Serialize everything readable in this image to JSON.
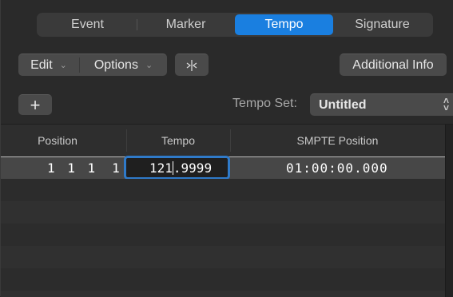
{
  "tabs": [
    {
      "label": "Event"
    },
    {
      "label": "Marker"
    },
    {
      "label": "Tempo"
    },
    {
      "label": "Signature"
    }
  ],
  "active_tab": "Tempo",
  "toolbar": {
    "edit_label": "Edit",
    "options_label": "Options",
    "catch_icon": "catch-playhead-icon",
    "additional_info_label": "Additional Info"
  },
  "tempo_set": {
    "add_label": "+",
    "label": "Tempo Set:",
    "value": "Untitled"
  },
  "table": {
    "columns": [
      "Position",
      "Tempo",
      "SMPTE Position"
    ],
    "rows": [
      {
        "position_bars": "1 1 1",
        "position_tick": "1",
        "tempo_before_caret": "121",
        "tempo_after_caret": ".9999",
        "smpte": "01:00:00.000"
      }
    ]
  },
  "colors": {
    "accent": "#1a7fe0",
    "focus_ring": "#2f7ac9"
  }
}
